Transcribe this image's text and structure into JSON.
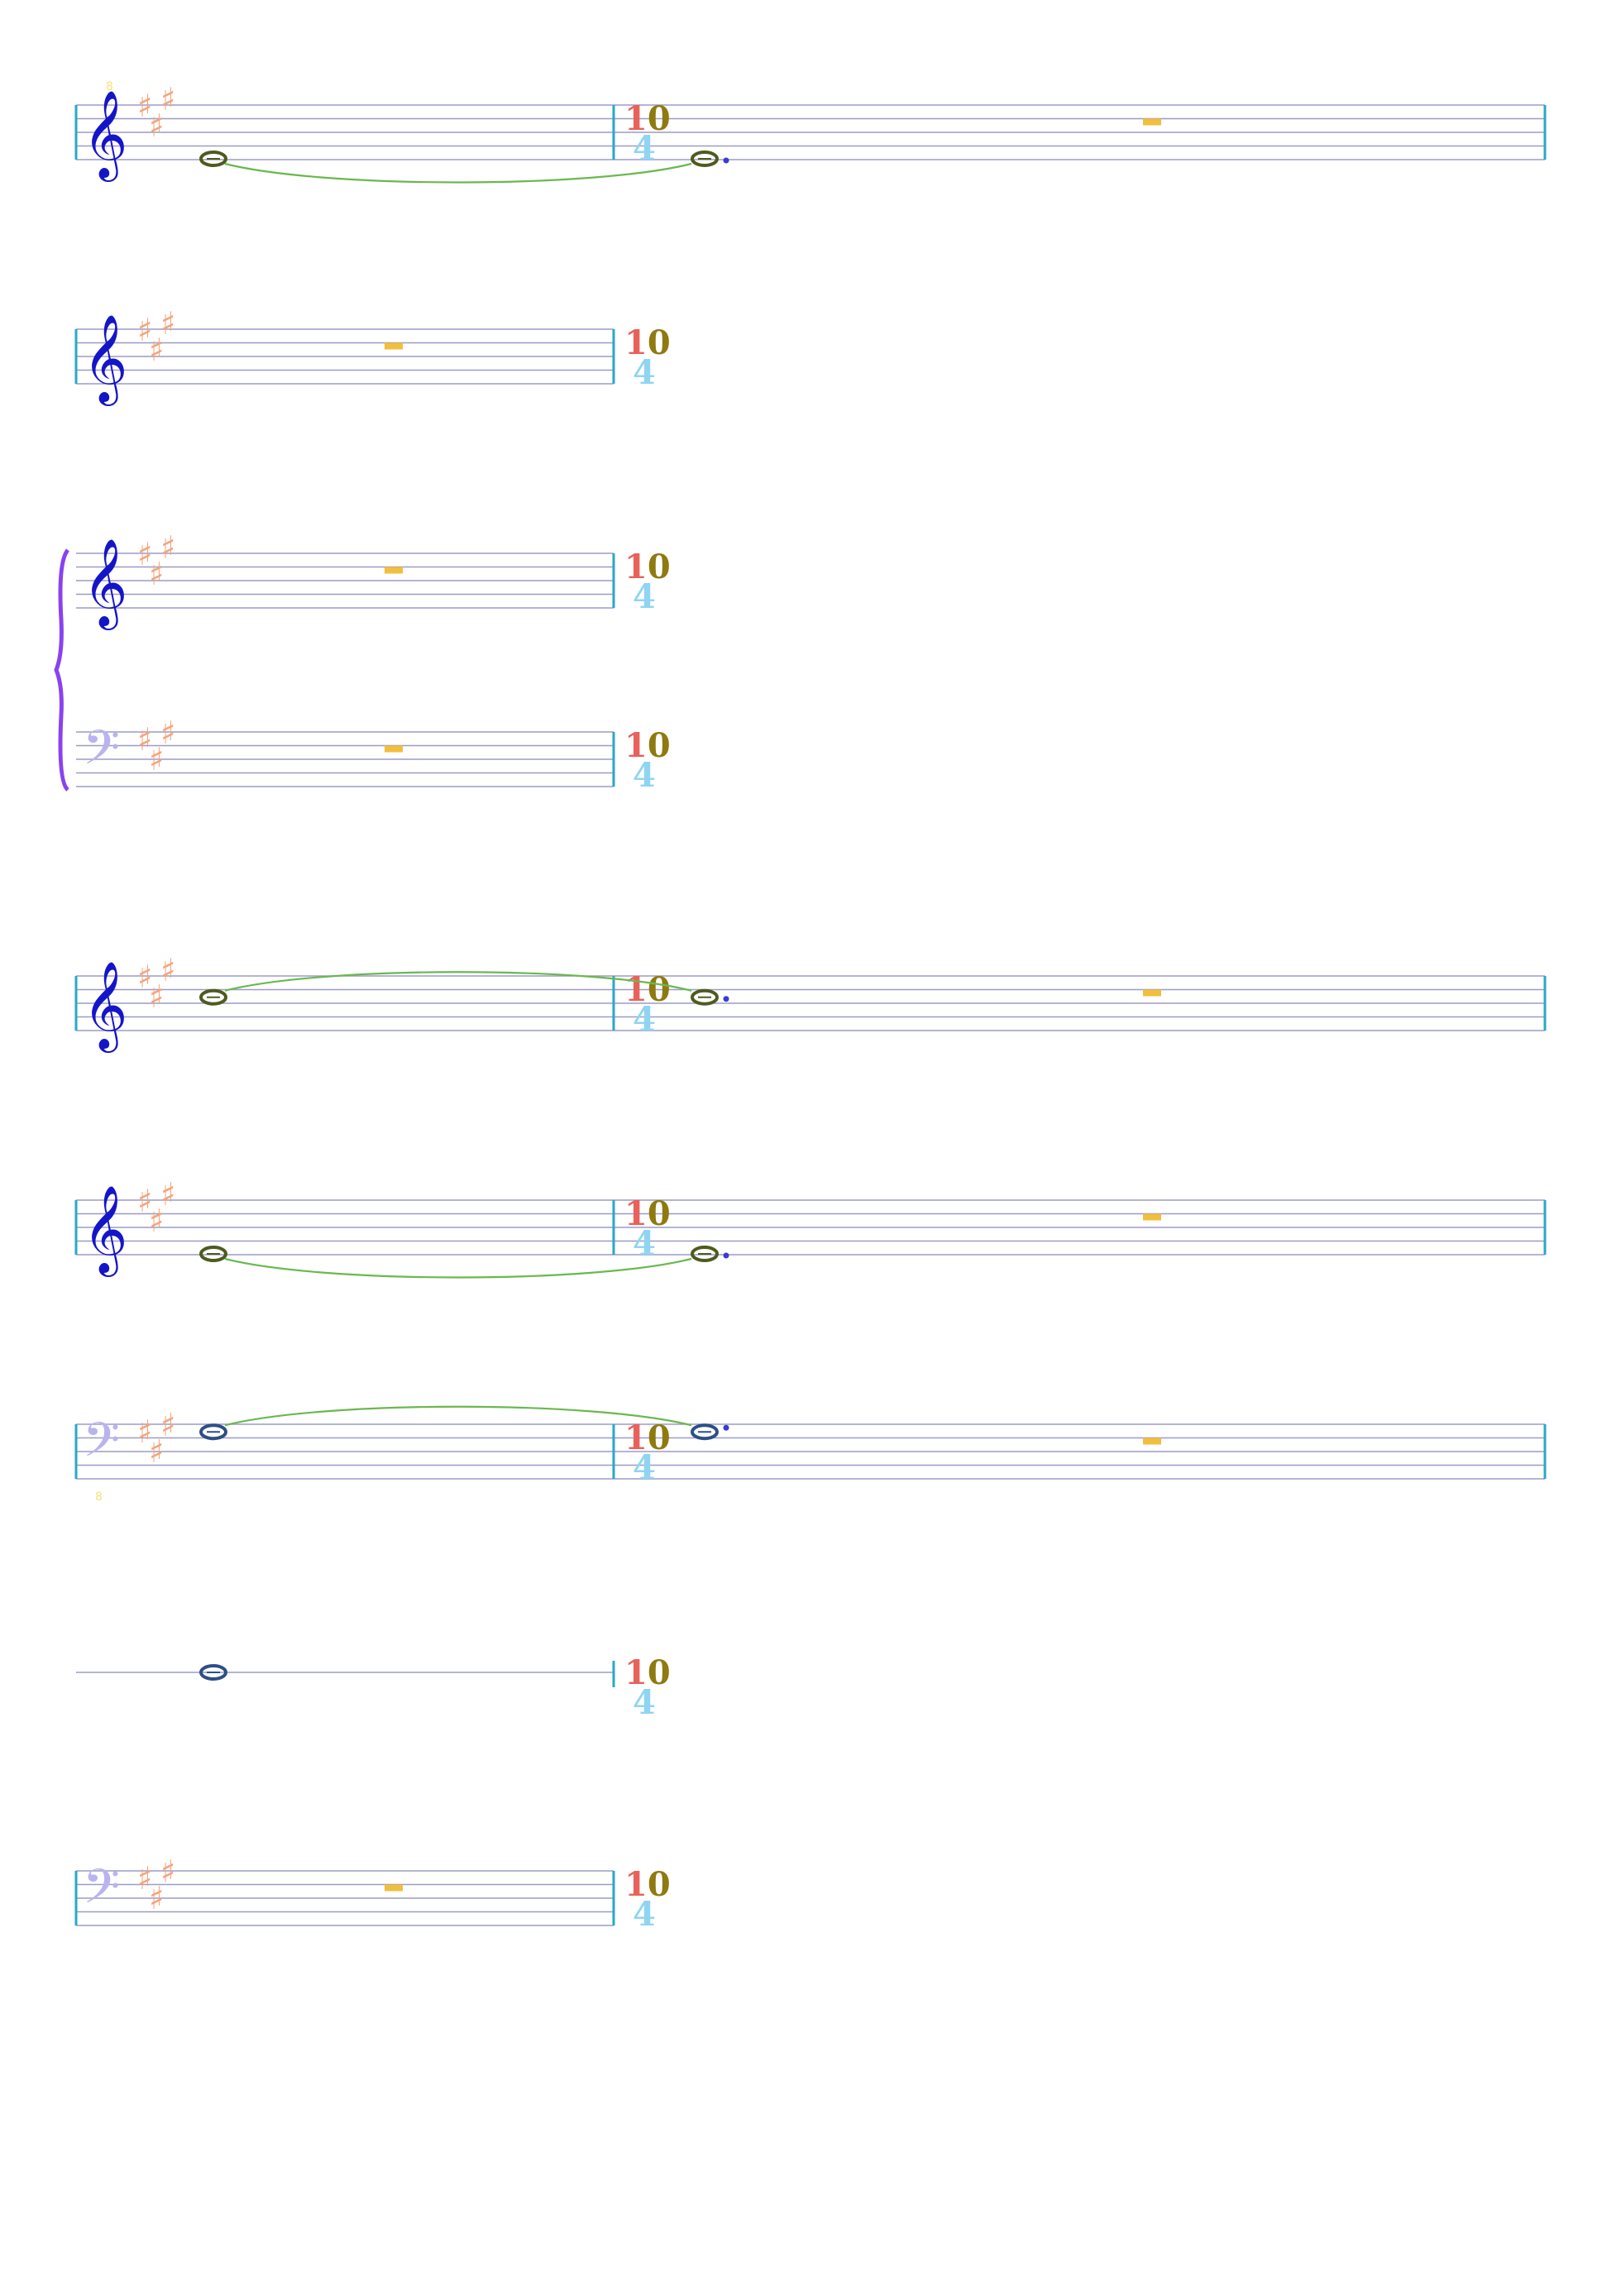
{
  "score": {
    "time_signature": {
      "numerator": "10",
      "denominator": "4"
    },
    "key_signature": {
      "accidental": "♯",
      "count": 3
    },
    "octave_mark": "8",
    "colors": {
      "staff_line": "#9b9bc8",
      "barline": "#2aa7c8",
      "treble_clef": "#1515c8",
      "bass_clef": "#b9b3f0",
      "key_signature": "#f4a37a",
      "ts_numerator_one": "#e8615a",
      "ts_numerator_zero": "#8f7a10",
      "ts_denominator": "#8fd5f2",
      "note_dark": "#4f5a1e",
      "note_blue": "#2d4f86",
      "tie": "#6bb84e",
      "rest": "#f1bf3d",
      "dot": "#3b3bcf",
      "brace": "#8a42f0",
      "octave_mark": "#f6e27a"
    },
    "systems": [
      {
        "name": "system-1",
        "staves": [
          {
            "clef": "treble",
            "octave_above": true,
            "m1": "whole-note-tied",
            "m2": "dotted-whole-note-and-rest"
          }
        ]
      },
      {
        "name": "system-2",
        "staves": [
          {
            "clef": "treble",
            "m1": "whole-rest"
          }
        ]
      },
      {
        "name": "system-3",
        "brace": true,
        "staves": [
          {
            "clef": "treble",
            "m1": "whole-rest"
          },
          {
            "clef": "bass",
            "m1": "whole-rest"
          }
        ]
      },
      {
        "name": "system-4",
        "staves": [
          {
            "clef": "treble",
            "m1": "whole-note-tied",
            "m2": "dotted-whole-note-and-rest"
          }
        ]
      },
      {
        "name": "system-5",
        "staves": [
          {
            "clef": "treble",
            "m1": "whole-note-tied",
            "m2": "dotted-whole-note-and-rest"
          }
        ]
      },
      {
        "name": "system-6",
        "staves": [
          {
            "clef": "bass",
            "octave_below": true,
            "m1": "whole-note-tied",
            "m2": "dotted-whole-note-and-rest"
          }
        ]
      },
      {
        "name": "system-7",
        "staves": [
          {
            "clef": "percussion",
            "m1": "whole-note"
          }
        ]
      },
      {
        "name": "system-8",
        "staves": [
          {
            "clef": "bass",
            "m1": "whole-rest"
          }
        ]
      }
    ]
  }
}
